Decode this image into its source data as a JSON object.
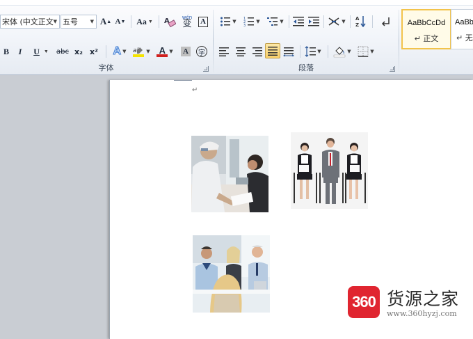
{
  "ribbon": {
    "font_group": {
      "label": "字体",
      "font_name": "宋体 (中文正文",
      "font_size": "五号",
      "grow_label": "A",
      "shrink_label": "A",
      "case_label": "Aa",
      "bold": "B",
      "italic": "I",
      "underline": "U",
      "strike": "abc",
      "subscript": "x₂",
      "superscript": "x²",
      "phonetic": "wén",
      "phonetic_char": "变",
      "char_border": "A",
      "text_effect": "A",
      "font_color": "A",
      "char_shading": "A",
      "enclose": "字"
    },
    "paragraph_group": {
      "label": "段落"
    },
    "styles": [
      {
        "sample": "AaBbCcDd",
        "name": "↵ 正文"
      },
      {
        "sample": "AaBb",
        "name": "↵ 无"
      }
    ]
  },
  "document": {
    "paragraph_mark": "↵"
  },
  "watermark": {
    "logo": "360",
    "title": "货源之家",
    "url": "www.360hyzj.com"
  },
  "colors": {
    "ribbon_bg": "#f1f4f9",
    "active_style_border": "#f2c34b",
    "logo_red": "#e02530",
    "font_color_bar": "#d0201e",
    "highlight_bar": "#f5e400"
  }
}
